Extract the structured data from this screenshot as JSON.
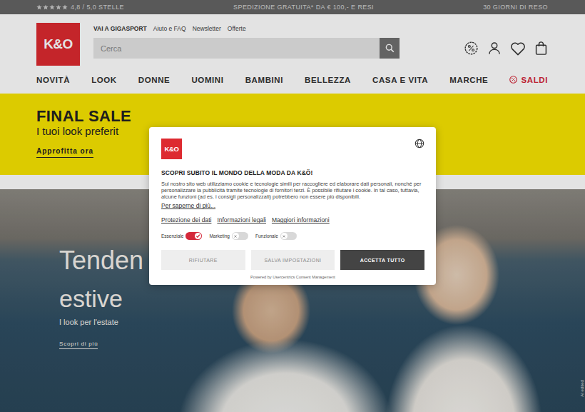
{
  "top_bar": {
    "stars": 5,
    "rating": "4,8 / 5,0 STELLE",
    "shipping": "SPEDIZIONE GRATUITA* DA € 100,- E RESI",
    "returns": "30 GIORNI DI RESO"
  },
  "header": {
    "logo": "K&O",
    "links": [
      {
        "label": "VAI A GIGASPORT",
        "kind": "bold"
      },
      {
        "label": "Aiuto e FAQ",
        "kind": "plain"
      },
      {
        "label": "Newsletter",
        "kind": "plain"
      },
      {
        "label": "Offerte",
        "kind": "plain"
      }
    ],
    "search": {
      "placeholder": "Cerca"
    }
  },
  "nav": [
    {
      "label": "NOVITÀ",
      "kind": "plain"
    },
    {
      "label": "LOOK",
      "kind": "plain"
    },
    {
      "label": "DONNE",
      "kind": "plain"
    },
    {
      "label": "UOMINI",
      "kind": "plain"
    },
    {
      "label": "BAMBINI",
      "kind": "plain"
    },
    {
      "label": "BELLEZZA",
      "kind": "plain"
    },
    {
      "label": "CASA E VITA",
      "kind": "plain"
    },
    {
      "label": "MARCHE",
      "kind": "plain"
    },
    {
      "label": "SALDI",
      "kind": "sale"
    }
  ],
  "promo": {
    "title": "FINAL SALE",
    "subtitle": "I tuoi look preferit",
    "link": "Approfitta ora"
  },
  "hero": {
    "title_line1": "Tenden",
    "title_line2": "estive",
    "subtitle": "I look per l'estate",
    "link": "Scopri di più",
    "watermark": "AI edited"
  },
  "consent": {
    "logo": "K&O",
    "title": "SCOPRI SUBITO IL MONDO DELLA MODA DA K&Ö!",
    "text": "Sul nostro sito web utilizziamo cookie e tecnologie simili per raccogliere ed elaborare dati personali, nonché per personalizzare la pubblicità tramite tecnologie di fornitori terzi. È possibile rifiutare i cookie. In tal caso, tuttavia, alcune funzioni (ad es. i consigli personalizzati) potrebbero non essere più disponibili.",
    "more": "Per saperne di più...",
    "links": [
      "Protezione dei dati",
      "Informazioni legali",
      "Maggiori informazioni"
    ],
    "toggles": [
      {
        "label": "Essenziale",
        "on": true
      },
      {
        "label": "Marketing",
        "on": false
      },
      {
        "label": "Funzionale",
        "on": false
      }
    ],
    "buttons": [
      {
        "label": "RIFIUTARE",
        "kind": "secondary"
      },
      {
        "label": "SALVA IMPOSTAZIONI",
        "kind": "secondary"
      },
      {
        "label": "ACCETTA TUTTO",
        "kind": "primary"
      }
    ],
    "powered": "Powered by Usercentrics Consent Management"
  }
}
